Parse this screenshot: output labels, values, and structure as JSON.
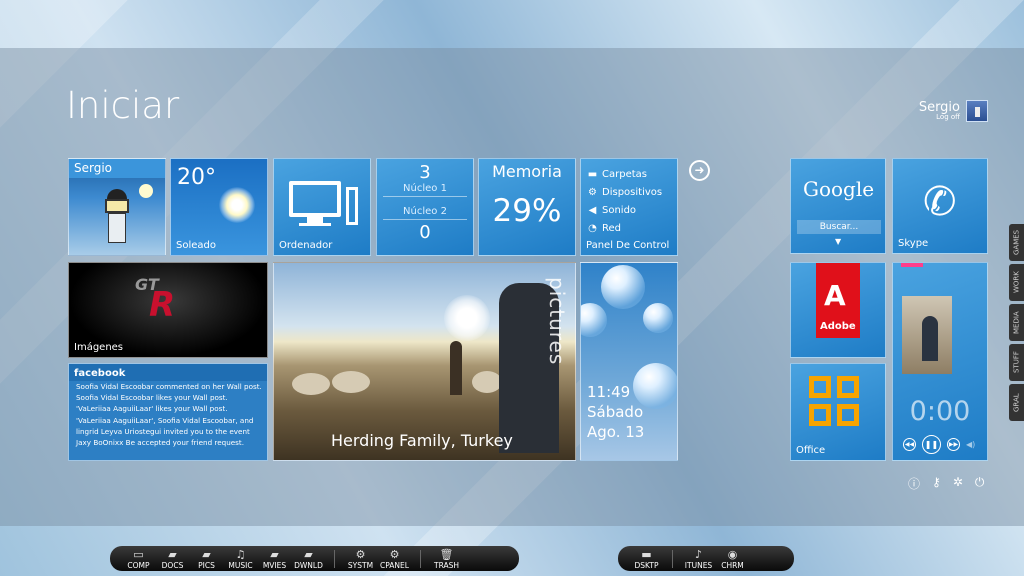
{
  "start": {
    "title": "Iniciar",
    "user": {
      "name": "Sergio",
      "logoff": "Log off"
    }
  },
  "tiles": {
    "user": {
      "label": "Sergio"
    },
    "weather": {
      "temp": "20°",
      "label": "Soleado"
    },
    "computer": {
      "label": "Ordenador"
    },
    "cpu": {
      "core1_value": "3",
      "core1_label": "Núcleo 1",
      "core2_label": "Núcleo 2",
      "core2_value": "0"
    },
    "memory": {
      "title": "Memoria",
      "value": "29%"
    },
    "control_panel": {
      "items": [
        {
          "icon": "folder-icon",
          "label": "Carpetas"
        },
        {
          "icon": "gear-icon",
          "label": "Dispositivos"
        },
        {
          "icon": "speaker-icon",
          "label": "Sonido"
        },
        {
          "icon": "wifi-icon",
          "label": "Red"
        }
      ],
      "label": "Panel De Control"
    },
    "images": {
      "label": "Imágenes"
    },
    "facebook": {
      "title": "facebook",
      "lines": [
        "Soofia Vidal Escoobar commented on her Wall post.",
        "Soofia Vidal Escoobar likes your Wall post.",
        "'VaLeriiaa AaguiiLaar' likes your Wall post.",
        "'VaLeriiaa AaguiiLaar', Soofia Vidal Escoobar, and",
        "lingrid Leyva Uriostegui invited you to the event",
        "Jaxy BoOnixx Be accepted your friend request."
      ]
    },
    "pictures": {
      "vertical_label": "pictures",
      "caption": "Herding Family, Turkey"
    },
    "clock": {
      "time": "11:49",
      "day": "Sábado",
      "date": "Ago. 13"
    },
    "google": {
      "logo": "Google",
      "search_placeholder": "Buscar..."
    },
    "skype": {
      "label": "Skype"
    },
    "adobe": {
      "logo_text": "Adobe"
    },
    "office": {
      "label": "Office"
    },
    "music": {
      "time": "0:00"
    }
  },
  "side_tabs": [
    "GAMES",
    "WORK",
    "MEDIA",
    "STUFF",
    "GRAL"
  ],
  "dock_left": [
    {
      "icon": "computer-icon",
      "label": "COMP"
    },
    {
      "icon": "folder-icon",
      "label": "DOCS"
    },
    {
      "icon": "pictures-folder-icon",
      "label": "PICS"
    },
    {
      "icon": "music-folder-icon",
      "label": "MUSIC"
    },
    {
      "icon": "movies-folder-icon",
      "label": "MVIES"
    },
    {
      "icon": "download-folder-icon",
      "label": "DWNLD"
    },
    {
      "icon": "gears-icon",
      "label": "SYSTM"
    },
    {
      "icon": "gears-icon",
      "label": "CPANEL"
    },
    {
      "icon": "trash-icon",
      "label": "TRASH"
    }
  ],
  "dock_right": [
    {
      "icon": "desktop-icon",
      "label": "DSKTP"
    },
    {
      "icon": "itunes-icon",
      "label": "ITUNES"
    },
    {
      "icon": "chrome-icon",
      "label": "CHRM"
    }
  ],
  "colors": {
    "tile": "#2b8ad4",
    "facebook_header": "#1f6eb3",
    "adobe_red": "#e0101a",
    "office_orange": "#f7a400"
  }
}
